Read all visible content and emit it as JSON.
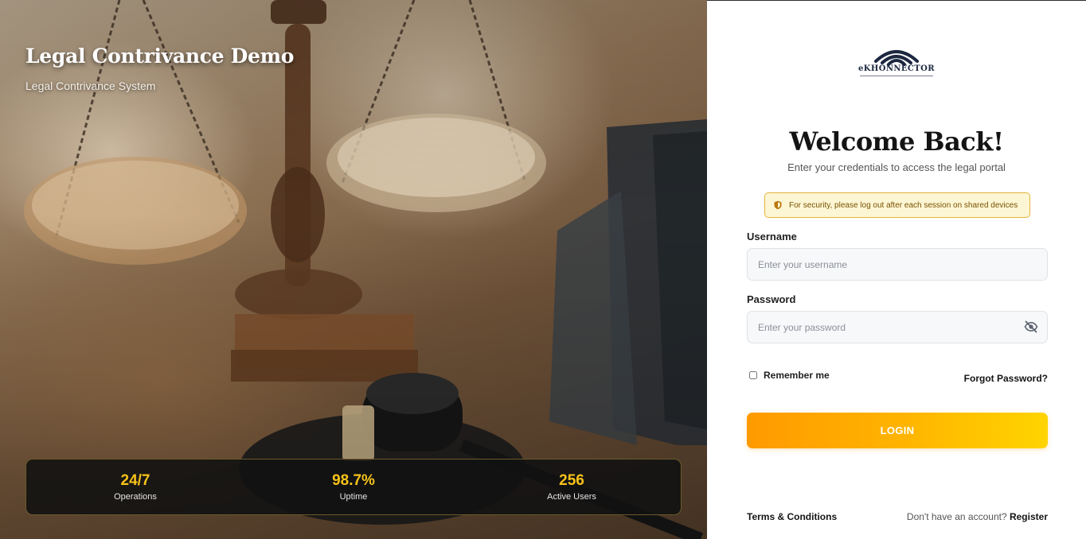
{
  "hero": {
    "title": "Legal Contrivance Demo",
    "subtitle": "Legal Contrivance System",
    "stats": [
      {
        "value": "24/7",
        "label": "Operations"
      },
      {
        "value": "98.7%",
        "label": "Uptime"
      },
      {
        "value": "256",
        "label": "Active Users"
      }
    ]
  },
  "brand": {
    "logo_text": "eKHONNECTOR"
  },
  "login": {
    "heading": "Welcome Back!",
    "subheading": "Enter your credentials to access the legal portal",
    "security_notice": "For security, please log out after each session on shared devices",
    "username_label": "Username",
    "username_placeholder": "Enter your username",
    "username_value": "",
    "password_label": "Password",
    "password_placeholder": "Enter your password",
    "password_value": "",
    "remember_label": "Remember me",
    "remember_checked": false,
    "forgot_label": "Forgot Password?",
    "submit_label": "LOGIN"
  },
  "footer": {
    "terms_label": "Terms & Conditions",
    "account_prompt": "Don't have an account?",
    "register_label": "Register"
  },
  "colors": {
    "accent_start": "#ff9a00",
    "accent_end": "#ffd400",
    "stat_value": "#f6c21a",
    "notice_bg": "#fdf6d4",
    "notice_border": "#e3b43a"
  },
  "icons": {
    "notice": "shield-icon",
    "password_toggle": "eye-off-icon",
    "logo": "wifi-signal-icon"
  }
}
